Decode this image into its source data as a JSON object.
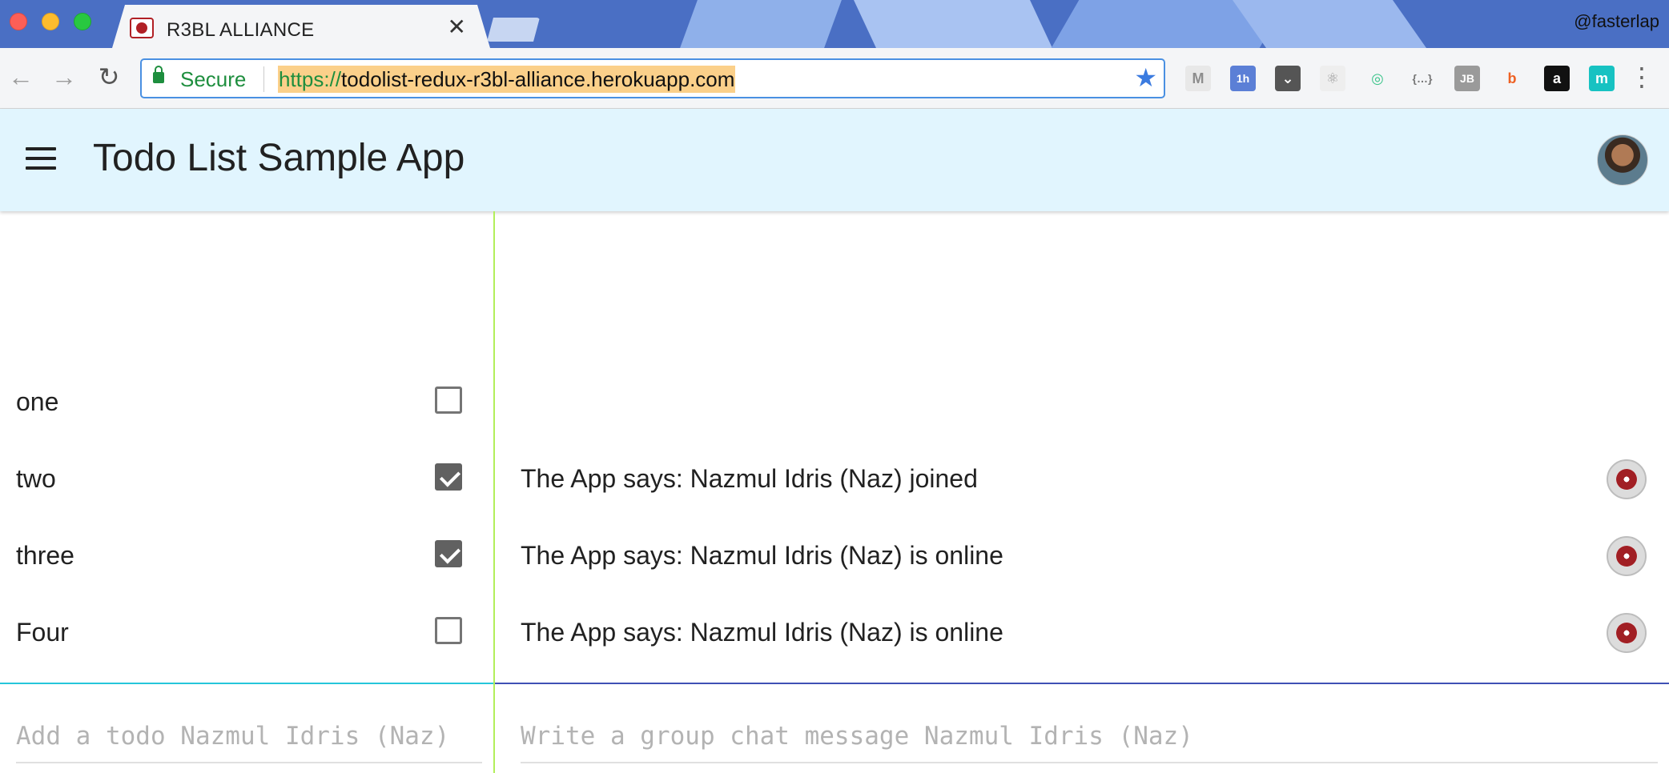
{
  "browser": {
    "tab": {
      "title": "R3BL ALLIANCE",
      "close_glyph": "✕"
    },
    "profile_name": "@fasterlap",
    "omnibox": {
      "secure_label": "Secure",
      "url_scheme": "https://",
      "url_host": "todolist-redux-r3bl-alliance.herokuapp.com"
    },
    "extensions": [
      {
        "name": "gmail-checker-icon",
        "glyph": "M",
        "color": "#8d8d8d",
        "bg": "#e8e8e8"
      },
      {
        "name": "calendar-icon",
        "glyph": "1h",
        "color": "#ffffff",
        "bg": "#5b7fd6"
      },
      {
        "name": "pocket-icon",
        "glyph": "⌄",
        "color": "#ffffff",
        "bg": "#555555"
      },
      {
        "name": "react-devtools-icon",
        "glyph": "⚛",
        "color": "#9c9c9c",
        "bg": "#eeeeee"
      },
      {
        "name": "momentum-icon",
        "glyph": "◎",
        "color": "#3ac48a",
        "bg": "#f4f5f7"
      },
      {
        "name": "json-viewer-icon",
        "glyph": "{…}",
        "color": "#777777",
        "bg": "#f4f5f7"
      },
      {
        "name": "jetbrains-icon",
        "glyph": "JB",
        "color": "#ffffff",
        "bg": "#9a9a9a"
      },
      {
        "name": "bitly-icon",
        "glyph": "b",
        "color": "#ee6123",
        "bg": "#f4f5f7"
      },
      {
        "name": "amazon-icon",
        "glyph": "a",
        "color": "#ffffff",
        "bg": "#111111"
      },
      {
        "name": "mercury-icon",
        "glyph": "m",
        "color": "#ffffff",
        "bg": "#17c2c2"
      }
    ]
  },
  "app": {
    "title": "Todo List Sample App"
  },
  "todos": [
    {
      "label": "one",
      "checked": false
    },
    {
      "label": "two",
      "checked": true
    },
    {
      "label": "three",
      "checked": true
    },
    {
      "label": "Four",
      "checked": false
    }
  ],
  "chat": {
    "messages": [
      {
        "text": "The App says: Nazmul Idris (Naz) joined"
      },
      {
        "text": "The App says: Nazmul Idris (Naz) is online"
      },
      {
        "text": "The App says: Nazmul Idris (Naz) is online"
      }
    ]
  },
  "inputs": {
    "todo_placeholder": "Add a todo Nazmul Idris (Naz)",
    "chat_placeholder": "Write a group chat message Nazmul Idris (Naz)"
  },
  "colors": {
    "appbar_bg": "#e1f5fe",
    "divider_green": "#b2ef5a",
    "line_cyan": "#26c6da",
    "line_indigo": "#3f51b5",
    "checkbox_checked": "#616161"
  }
}
